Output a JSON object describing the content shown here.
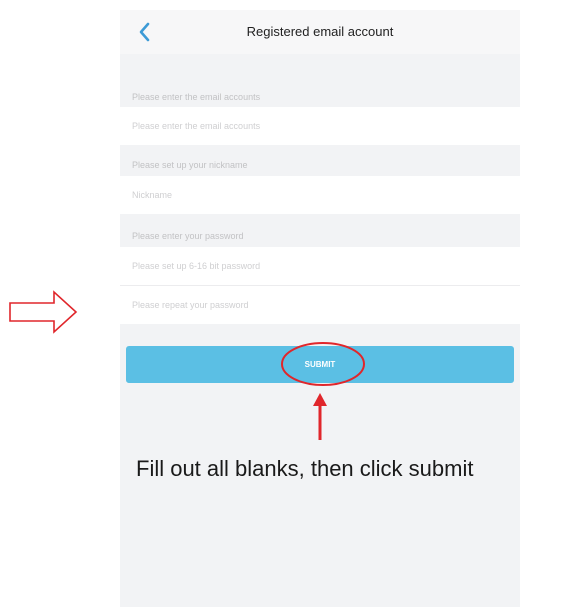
{
  "header": {
    "title": "Registered email account",
    "back_icon": "chevron-left-icon"
  },
  "form": {
    "email_section_label": "Please enter the email accounts",
    "email_placeholder": "Please enter the email accounts",
    "nickname_section_label": "Please set up your nickname",
    "nickname_placeholder": "Nickname",
    "password_section_label": "Please enter your password",
    "password_placeholder": "Please set up 6-16 bit password",
    "confirm_placeholder": "Please repeat your password",
    "submit_label": "SUBMIT"
  },
  "annotation": {
    "instruction": "Fill out all blanks, then click submit",
    "color": "#e0262b"
  },
  "colors": {
    "accent": "#5bbfe4",
    "background": "#f2f3f5",
    "annotation": "#e0262b"
  }
}
